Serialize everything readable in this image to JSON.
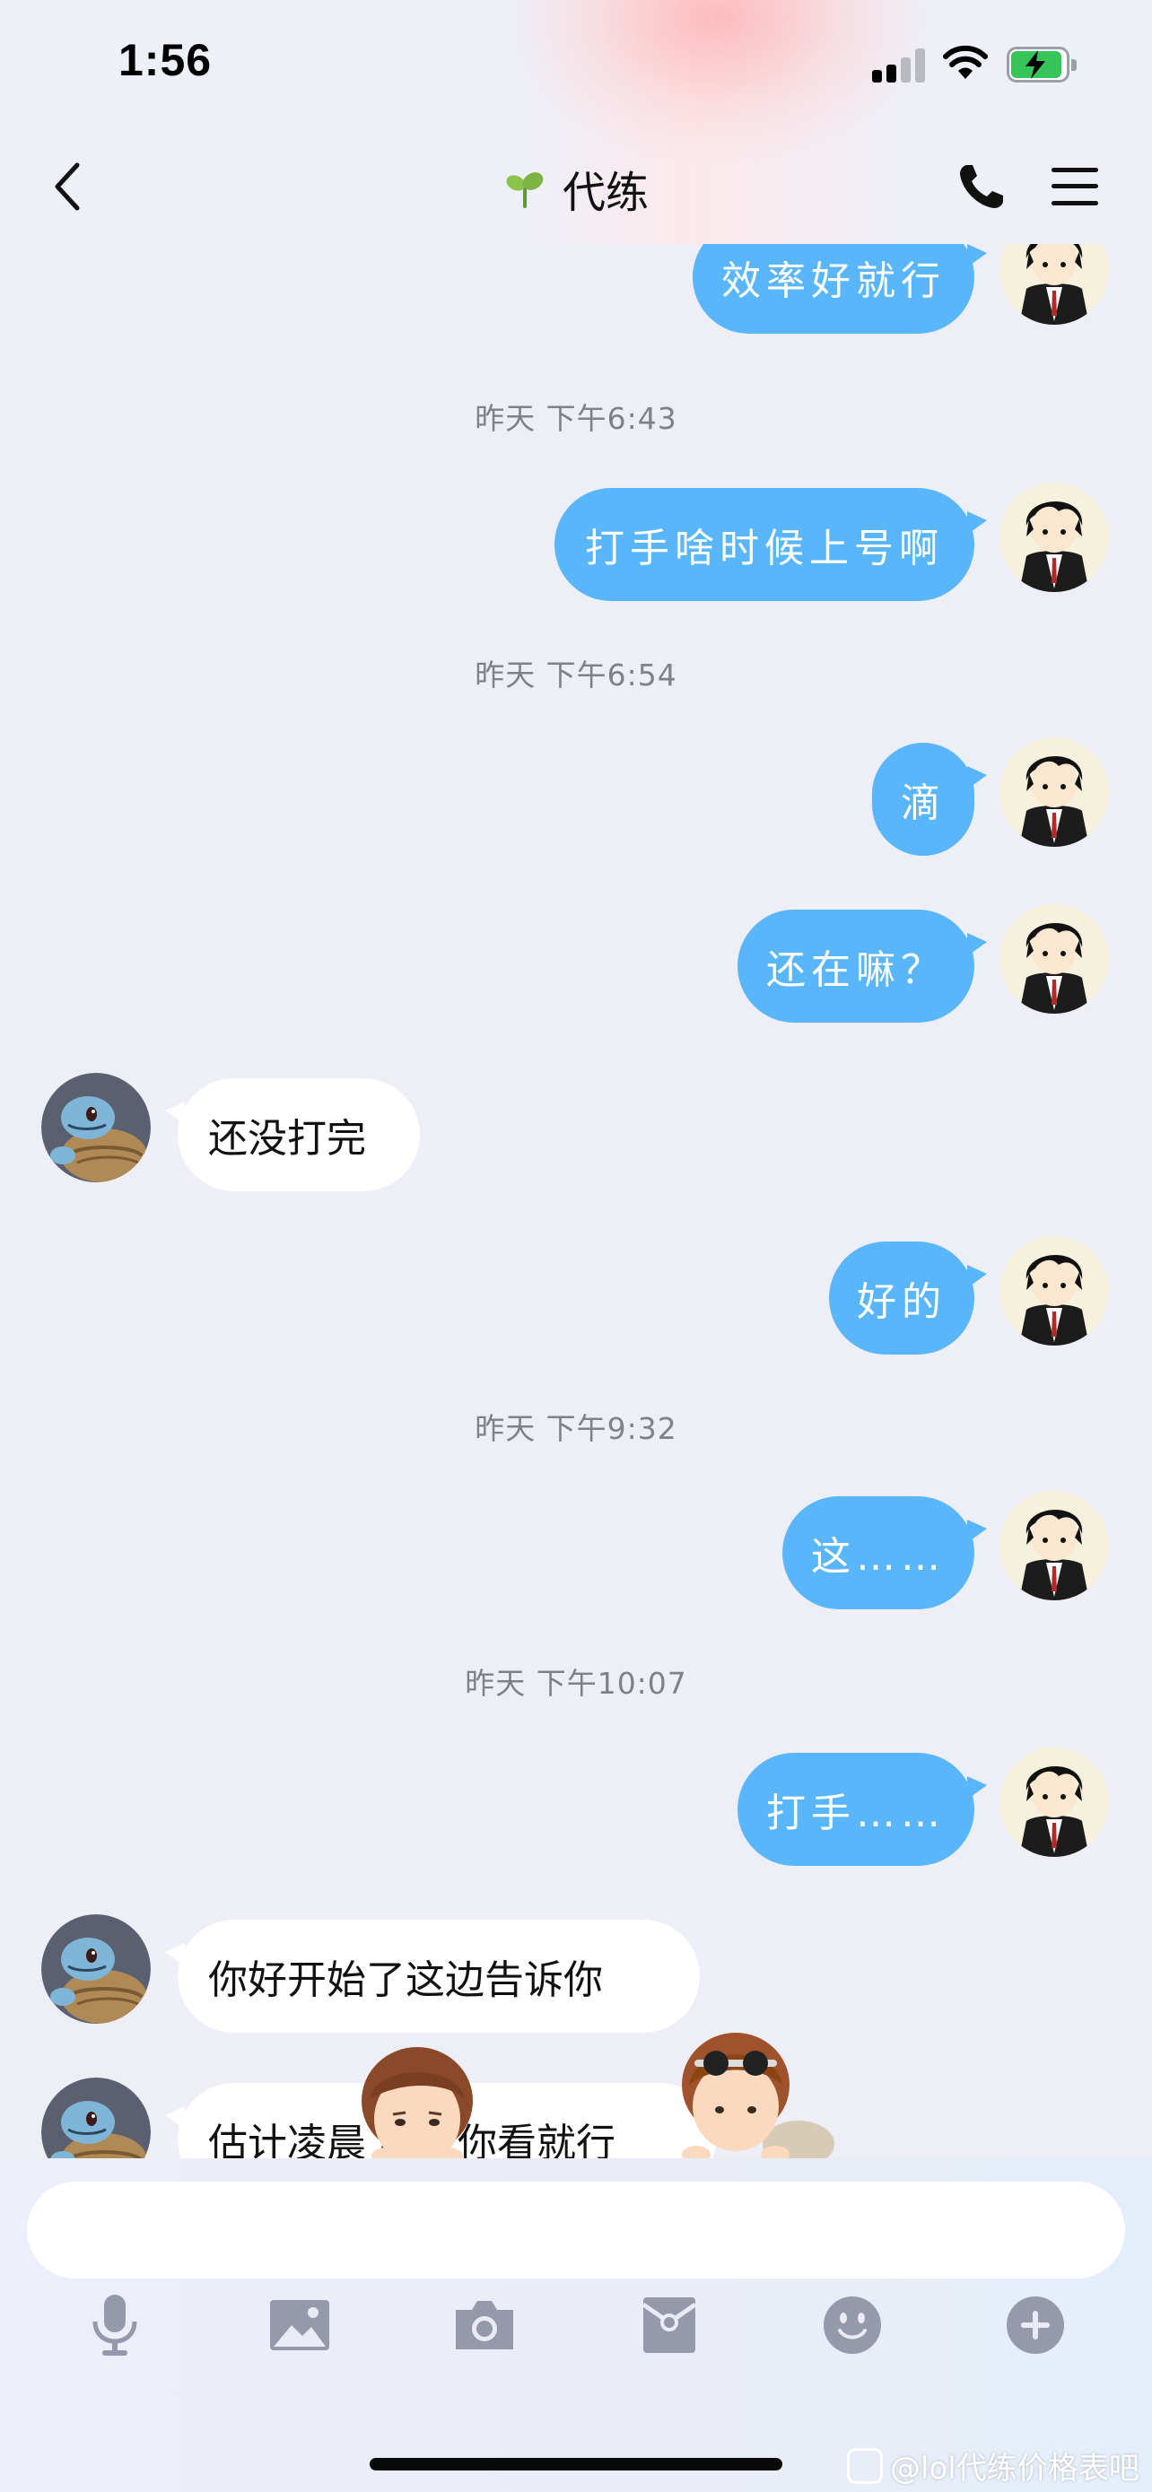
{
  "status_bar": {
    "time": "1:56",
    "signal_icon": "cellular-signal-icon",
    "wifi_icon": "wifi-icon",
    "battery_icon": "battery-charging-icon",
    "battery_color": "#37c55a"
  },
  "header": {
    "title": "代练",
    "back_icon": "chevron-left-icon",
    "title_icon": "sprout-icon",
    "call_icon": "phone-icon",
    "menu_icon": "menu-icon"
  },
  "messages": {
    "out_1": "效率好就行",
    "ts_1": "昨天 下午6:43",
    "out_2": "打手啥时候上号啊",
    "ts_2": "昨天 下午6:54",
    "out_3": "滴",
    "out_4": "还在嘛？",
    "in_1": "还没打完",
    "out_5": "好的",
    "ts_3": "昨天 下午9:32",
    "out_6": "这……",
    "ts_4": "昨天 下午10:07",
    "out_7": "打手……",
    "in_2": "你好开始了这边告诉你",
    "in_3": "估计凌晨 明天你看就行"
  },
  "toolbar": {
    "icons": [
      "microphone-icon",
      "image-icon",
      "camera-icon",
      "red-packet-icon",
      "emoji-icon",
      "plus-icon"
    ]
  },
  "watermark": {
    "text": "@lol代练价格表吧"
  },
  "colors": {
    "outgoing_bubble": "#5ab6fb",
    "incoming_bubble": "#ffffff",
    "background": "#edeef6",
    "timestamp": "#7f8089"
  }
}
